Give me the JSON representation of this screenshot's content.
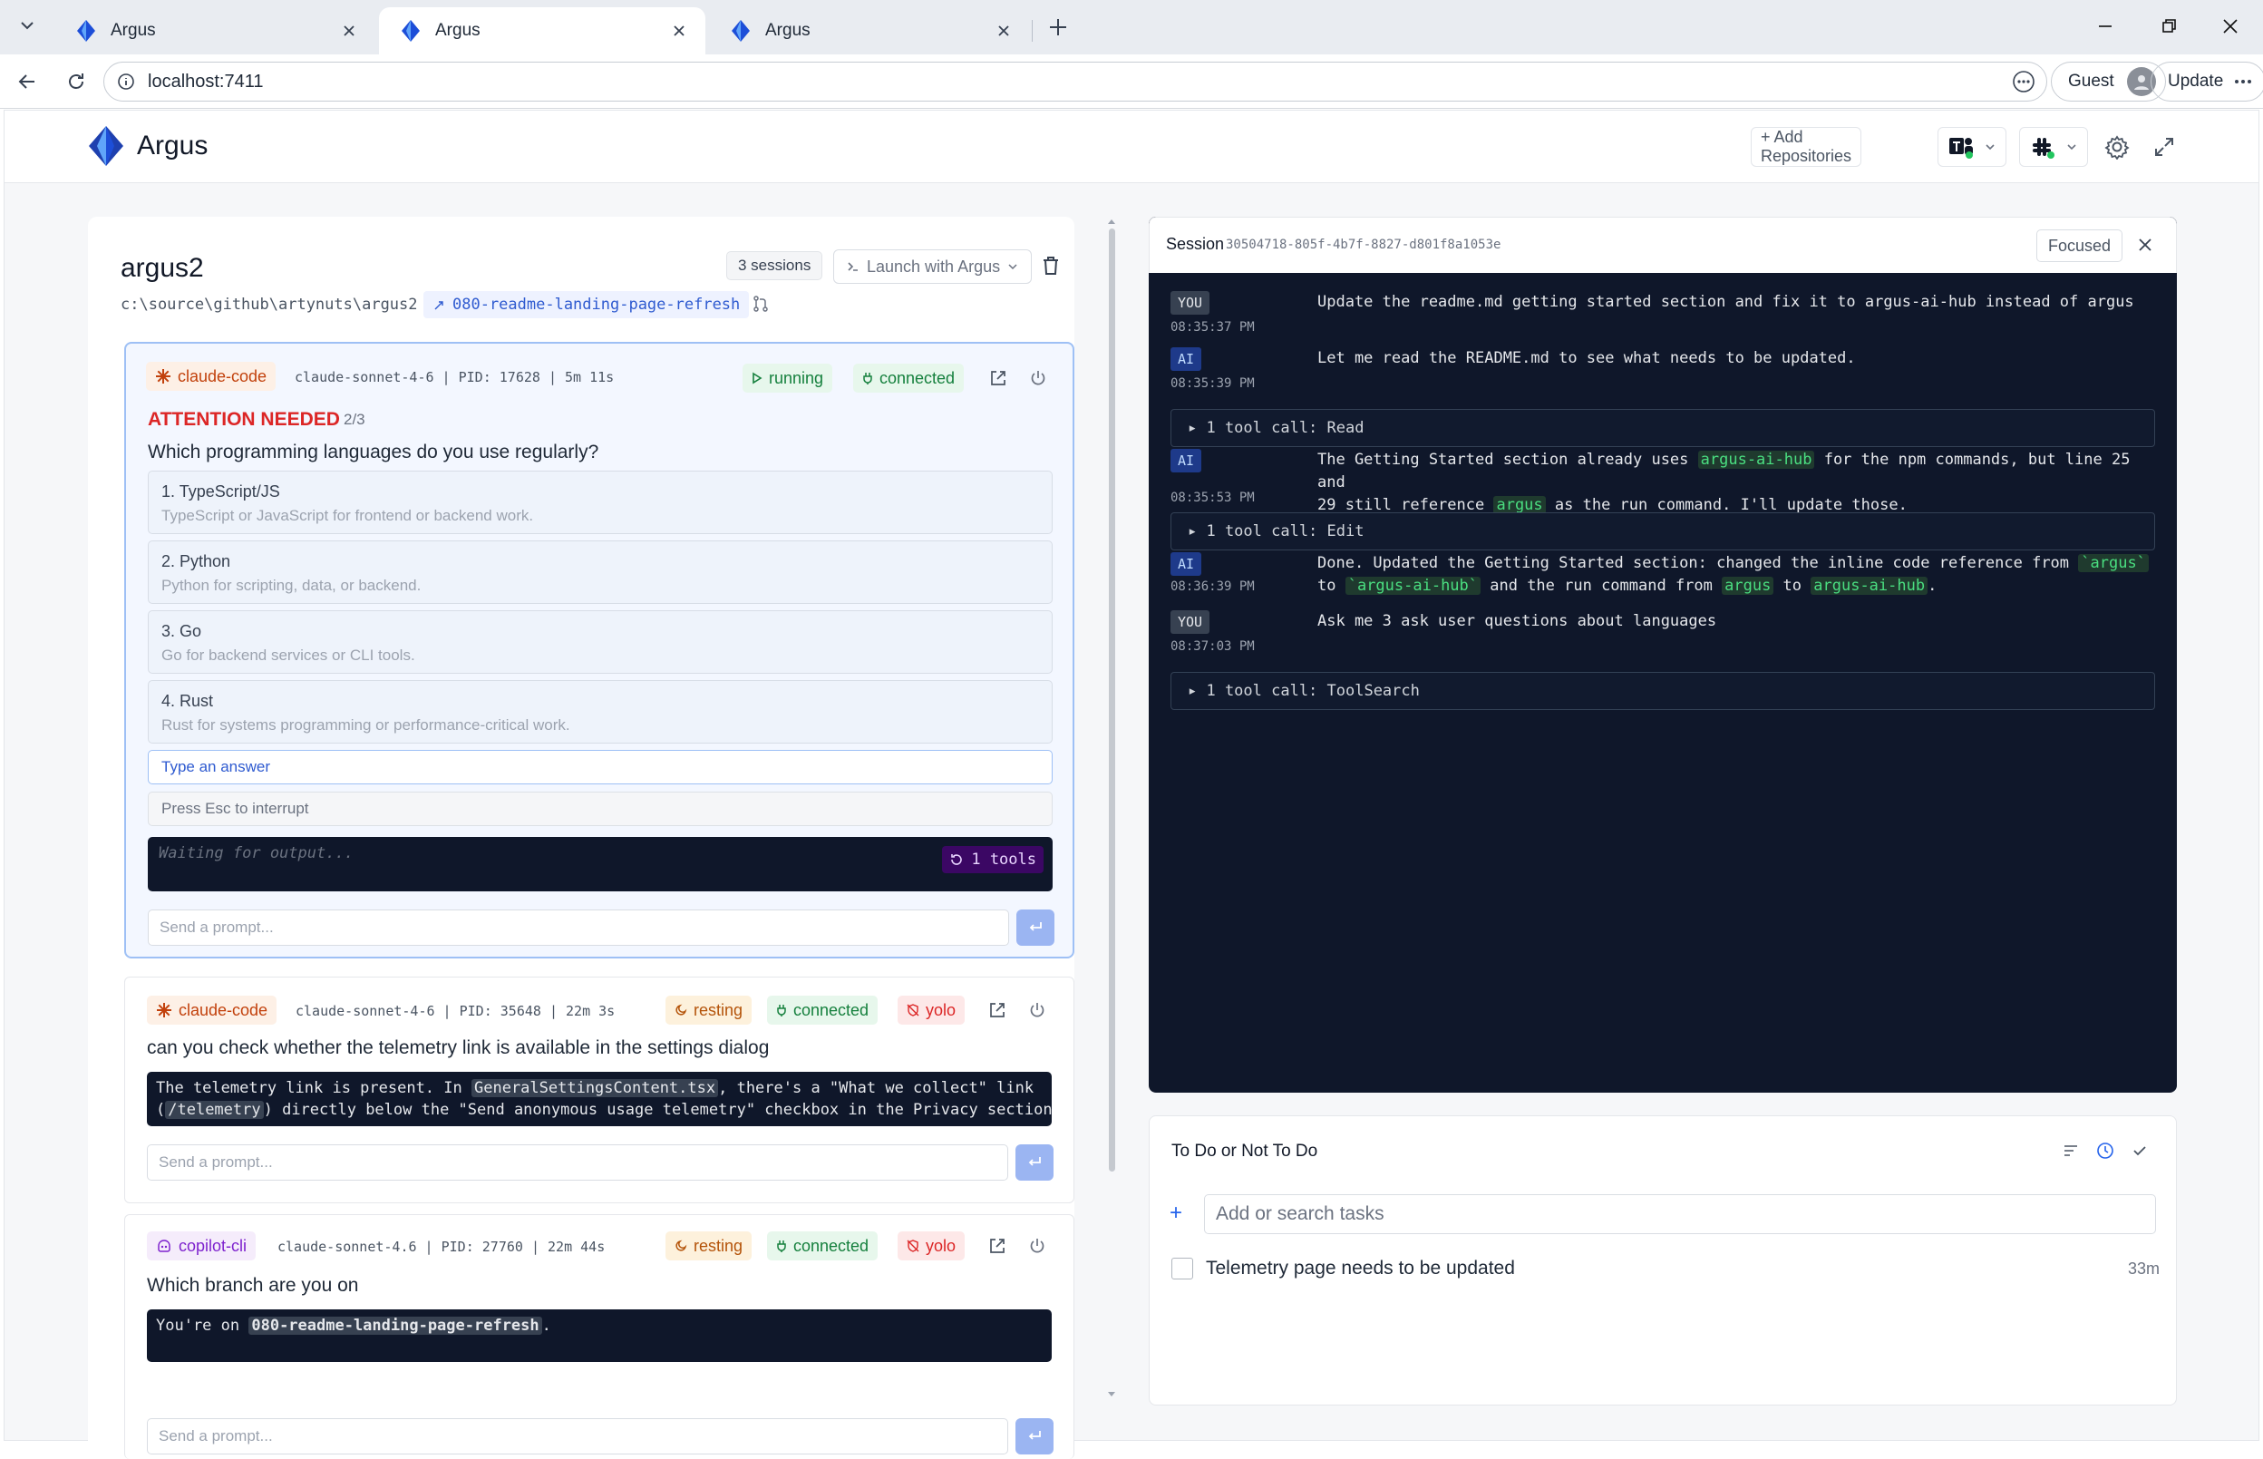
{
  "browser": {
    "tabs": [
      {
        "title": "Argus"
      },
      {
        "title": "Argus"
      },
      {
        "title": "Argus"
      }
    ],
    "url": "localhost:7411",
    "profile_label": "Guest",
    "update_label": "Update"
  },
  "header": {
    "brand": "Argus",
    "add_repositories": "+ Add Repositories"
  },
  "repo": {
    "name": "argus2",
    "sessions_count": "3 sessions",
    "launch_label": "Launch with Argus",
    "path": "c:\\source\\github\\artynuts\\argus2",
    "branch": "080-readme-landing-page-refresh"
  },
  "sessions": [
    {
      "agent": "claude-code",
      "meta": "claude-sonnet-4-6 | PID: 17628 | 5m 11s",
      "status": "running",
      "connection": "connected",
      "attention": "ATTENTION NEEDED",
      "attention_count": "2/3",
      "question": "Which programming languages do you use regularly?",
      "options": [
        {
          "label": "1. TypeScript/JS",
          "desc": "TypeScript or JavaScript for frontend or backend work."
        },
        {
          "label": "2. Python",
          "desc": "Python for scripting, data, or backend."
        },
        {
          "label": "3. Go",
          "desc": "Go for backend services or CLI tools."
        },
        {
          "label": "4. Rust",
          "desc": "Rust for systems programming or performance-critical work."
        }
      ],
      "answer_placeholder": "Type an answer",
      "esc_hint": "Press Esc to interrupt",
      "output": "Waiting for output...",
      "tools_badge": "1 tools",
      "prompt_placeholder": "Send a prompt..."
    },
    {
      "agent": "claude-code",
      "meta": "claude-sonnet-4-6 | PID: 35648 | 22m 3s",
      "status": "resting",
      "connection": "connected",
      "mode": "yolo",
      "question": "can you check whether the telemetry link is available in the settings dialog",
      "output_parts": [
        "The telemetry link is present. In ",
        "GeneralSettingsContent.tsx",
        ", there's a \"What we collect\" link"
      ],
      "output_line2_parts": [
        "(",
        "/telemetry",
        ") directly below the \"Send anonymous usage telemetry\" checkbox in the Privacy section…"
      ],
      "prompt_placeholder": "Send a prompt..."
    },
    {
      "agent": "copilot-cli",
      "meta": "claude-sonnet-4.6 | PID: 27760 | 22m 44s",
      "status": "resting",
      "connection": "connected",
      "mode": "yolo",
      "question": "Which branch are you on",
      "output_parts": [
        "You're on ",
        "080-readme-landing-page-refresh",
        "."
      ],
      "prompt_placeholder": "Send a prompt..."
    }
  ],
  "session_panel": {
    "title": "Session",
    "id": "30504718-805f-4b7f-8827-d801f8a1053e",
    "focused_label": "Focused",
    "messages": [
      {
        "who": "YOU",
        "time": "08:35:37 PM",
        "text": "Update the readme.md getting started section and fix it to argus-ai-hub instead of argus"
      },
      {
        "who": "AI",
        "time": "08:35:39 PM",
        "text": "Let me read the README.md to see what needs to be updated."
      },
      {
        "tool": "▸ 1 tool call: Read"
      },
      {
        "who": "AI",
        "time": "08:35:53 PM",
        "parts": [
          "The Getting Started section already uses ",
          "argus-ai-hub",
          " for the npm commands, but line 25 and"
        ],
        "parts2": [
          "29 still reference ",
          "argus",
          " as the run command. I'll update those."
        ]
      },
      {
        "tool": "▸ 1 tool call: Edit"
      },
      {
        "who": "AI",
        "time": "08:36:39 PM",
        "parts": [
          "Done. Updated the Getting Started section: changed the inline code reference from ",
          "`argus`"
        ],
        "parts2": [
          "to ",
          "`argus-ai-hub`",
          " and the run command from ",
          "argus",
          " to ",
          "argus-ai-hub",
          "."
        ]
      },
      {
        "who": "YOU",
        "time": "08:37:03 PM",
        "text": "Ask me 3 ask user questions about languages"
      },
      {
        "tool": "▸ 1 tool call: ToolSearch"
      }
    ]
  },
  "todo": {
    "title": "To Do or Not To Do",
    "search_placeholder": "Add or search tasks",
    "items": [
      {
        "text": "Telemetry page needs to be updated",
        "age": "33m"
      }
    ]
  },
  "colors": {
    "accent": "#2563eb",
    "danger": "#dc2626",
    "success": "#15803d",
    "warning": "#b45309",
    "terminal": "#0f172a"
  }
}
